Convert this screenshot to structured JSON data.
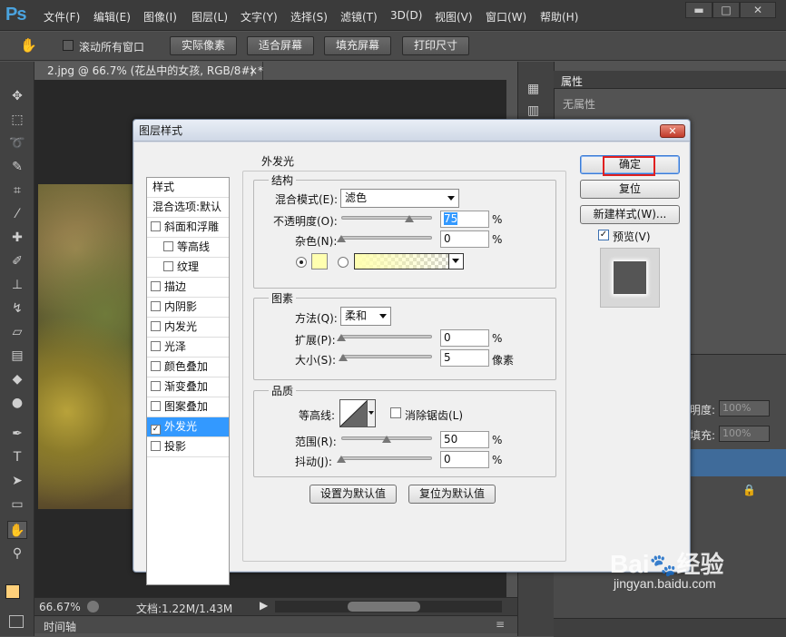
{
  "app": {
    "logo": "Ps"
  },
  "menu": [
    "文件(F)",
    "编辑(E)",
    "图像(I)",
    "图层(L)",
    "文字(Y)",
    "选择(S)",
    "滤镜(T)",
    "3D(D)",
    "视图(V)",
    "窗口(W)",
    "帮助(H)"
  ],
  "window_buttons": {
    "minimize": "▬",
    "restore": "□",
    "close": "✕"
  },
  "options": {
    "scroll_all": "滚动所有窗口",
    "actual_pixels": "实际像素",
    "fit_screen": "适合屏幕",
    "fill_screen": "填充屏幕",
    "print_size": "打印尺寸"
  },
  "document": {
    "tab": "2.jpg @ 66.7% (花丛中的女孩, RGB/8#) *",
    "close": "×"
  },
  "status": {
    "zoom": "66.67%",
    "doc": "文档:1.22M/1.43M"
  },
  "timeline": {
    "label": "时间轴"
  },
  "properties": {
    "tab": "属性",
    "empty": "无属性"
  },
  "layers": {
    "opacity_label": "明度:",
    "opacity_value": "100%",
    "fill_label": "填充:",
    "fill_value": "100%"
  },
  "dialog": {
    "title": "图层样式",
    "close": "✕",
    "styles_header": "样式",
    "blend_options": "混合选项:默认",
    "style_items": [
      {
        "label": "斜面和浮雕",
        "checked": false,
        "indent": false
      },
      {
        "label": "等高线",
        "checked": false,
        "indent": true
      },
      {
        "label": "纹理",
        "checked": false,
        "indent": true
      },
      {
        "label": "描边",
        "checked": false,
        "indent": false
      },
      {
        "label": "内阴影",
        "checked": false,
        "indent": false
      },
      {
        "label": "内发光",
        "checked": false,
        "indent": false
      },
      {
        "label": "光泽",
        "checked": false,
        "indent": false
      },
      {
        "label": "颜色叠加",
        "checked": false,
        "indent": false
      },
      {
        "label": "渐变叠加",
        "checked": false,
        "indent": false
      },
      {
        "label": "图案叠加",
        "checked": false,
        "indent": false
      },
      {
        "label": "外发光",
        "checked": true,
        "indent": false,
        "selected": true
      },
      {
        "label": "投影",
        "checked": false,
        "indent": false
      }
    ],
    "section_title": "外发光",
    "structure": {
      "title": "结构",
      "blend_mode_label": "混合模式(E):",
      "blend_mode_value": "滤色",
      "opacity_label": "不透明度(O):",
      "opacity_value": "75",
      "opacity_unit": "%",
      "opacity_fraction": 0.75,
      "noise_label": "杂色(N):",
      "noise_value": "0",
      "noise_unit": "%",
      "noise_fraction": 0,
      "glow_color": "#ffffb0"
    },
    "elements": {
      "title": "图素",
      "technique_label": "方法(Q):",
      "technique_value": "柔和",
      "spread_label": "扩展(P):",
      "spread_value": "0",
      "spread_unit": "%",
      "spread_fraction": 0,
      "size_label": "大小(S):",
      "size_value": "5",
      "size_unit": "像素",
      "size_fraction": 0.02
    },
    "quality": {
      "title": "品质",
      "contour_label": "等高线:",
      "antialias_label": "消除锯齿(L)",
      "range_label": "范围(R):",
      "range_value": "50",
      "range_unit": "%",
      "range_fraction": 0.5,
      "jitter_label": "抖动(J):",
      "jitter_value": "0",
      "jitter_unit": "%",
      "jitter_fraction": 0
    },
    "set_default": "设置为默认值",
    "reset_default": "复位为默认值",
    "ok": "确定",
    "reset": "复位",
    "new_style": "新建样式(W)...",
    "preview": "预览(V)",
    "accent_red": "#e02020"
  },
  "watermark": {
    "brand": "Bai",
    "paw": "🐾",
    "brand2": "经验",
    "url": "jingyan.baidu.com"
  }
}
